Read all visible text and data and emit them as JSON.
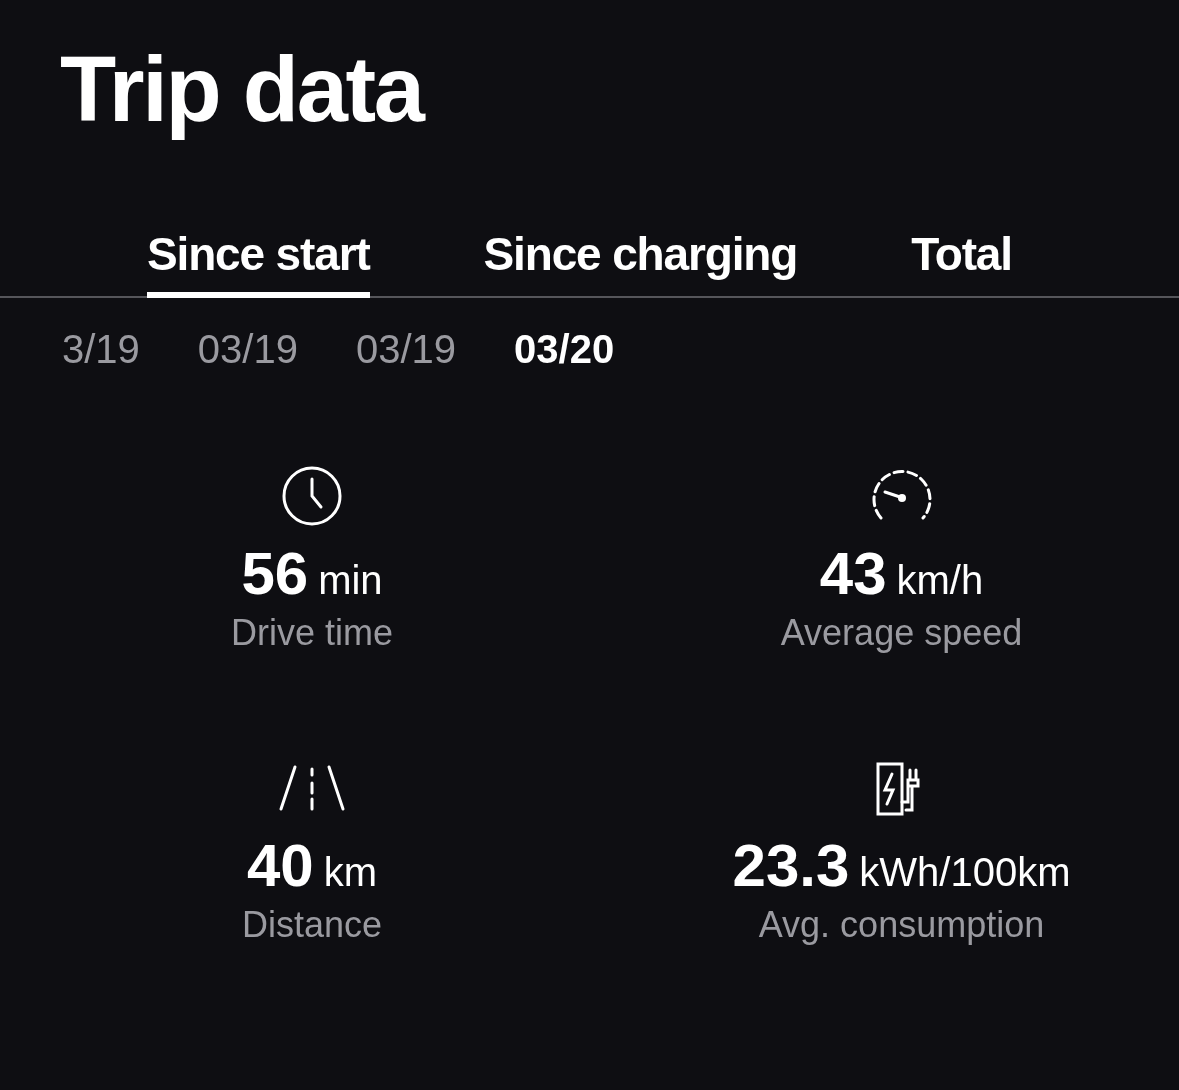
{
  "title": "Trip data",
  "tabs": [
    {
      "label": "Since start",
      "selected": true
    },
    {
      "label": "Since charging",
      "selected": false
    },
    {
      "label": "Total",
      "selected": false
    }
  ],
  "dates": [
    {
      "label": "3/19",
      "selected": false
    },
    {
      "label": "03/19",
      "selected": false
    },
    {
      "label": "03/19",
      "selected": false
    },
    {
      "label": "03/20",
      "selected": true
    }
  ],
  "stats": [
    {
      "kind": "clock",
      "value": "56",
      "unit": "min",
      "label": "Drive time"
    },
    {
      "kind": "speed",
      "value": "43",
      "unit": "km/h",
      "label": "Average speed"
    },
    {
      "kind": "road",
      "value": "40",
      "unit": "km",
      "label": "Distance"
    },
    {
      "kind": "charger",
      "value": "23.3",
      "unit": "kWh/100km",
      "label": "Avg. consumption"
    }
  ]
}
